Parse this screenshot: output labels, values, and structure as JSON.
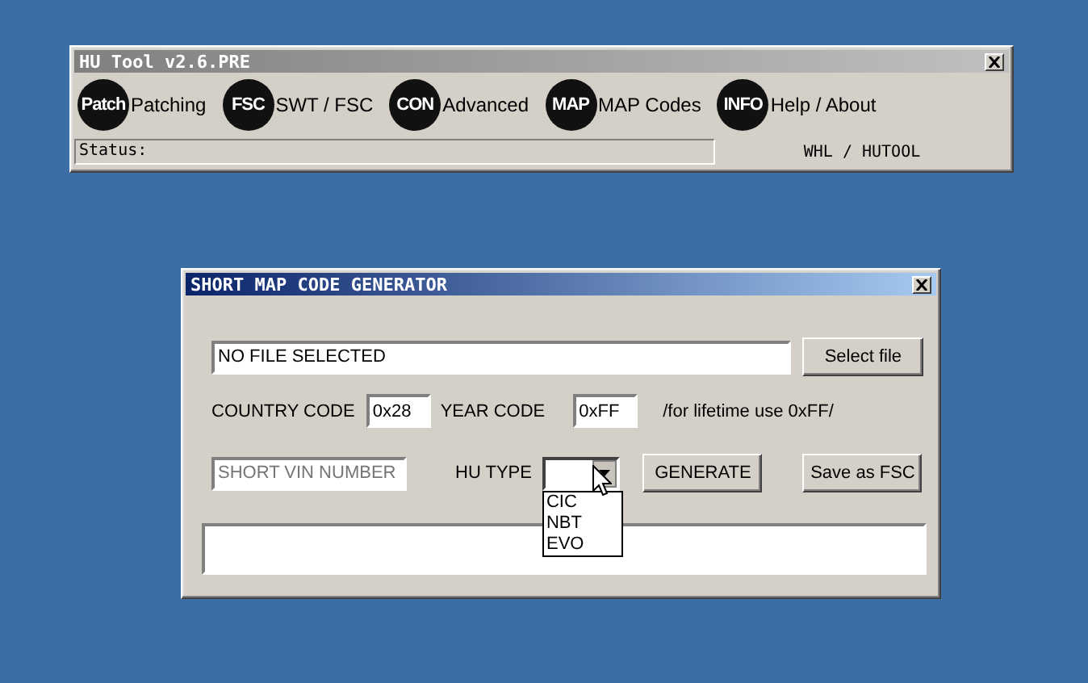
{
  "main_window": {
    "title": "HU Tool v2.6.PRE",
    "toolbar": [
      {
        "badge": "Patch",
        "label": "Patching"
      },
      {
        "badge": "FSC",
        "label": "SWT / FSC"
      },
      {
        "badge": "CON",
        "label": "Advanced"
      },
      {
        "badge": "MAP",
        "label": "MAP Codes"
      },
      {
        "badge": "INFO",
        "label": "Help / About"
      }
    ],
    "status_bar": {
      "status": "Status:",
      "credit": "WHL / HUTOOL"
    }
  },
  "dialog": {
    "title": "SHORT MAP CODE GENERATOR",
    "file_field": {
      "value": "NO FILE SELECTED"
    },
    "select_button": "Select file",
    "country_label": "COUNTRY CODE",
    "country_value": "0x28",
    "year_label": "YEAR CODE",
    "year_value": "0xFF",
    "hint": "/for lifetime use 0xFF/",
    "vin_field": {
      "placeholder": "SHORT VIN NUMBER"
    },
    "hu_type_label": "HU TYPE",
    "hu_type": {
      "expanded": true,
      "options": [
        "CIC",
        "NBT",
        "EVO"
      ]
    },
    "generate_button": "GENERATE",
    "save_button": "Save as FSC"
  }
}
